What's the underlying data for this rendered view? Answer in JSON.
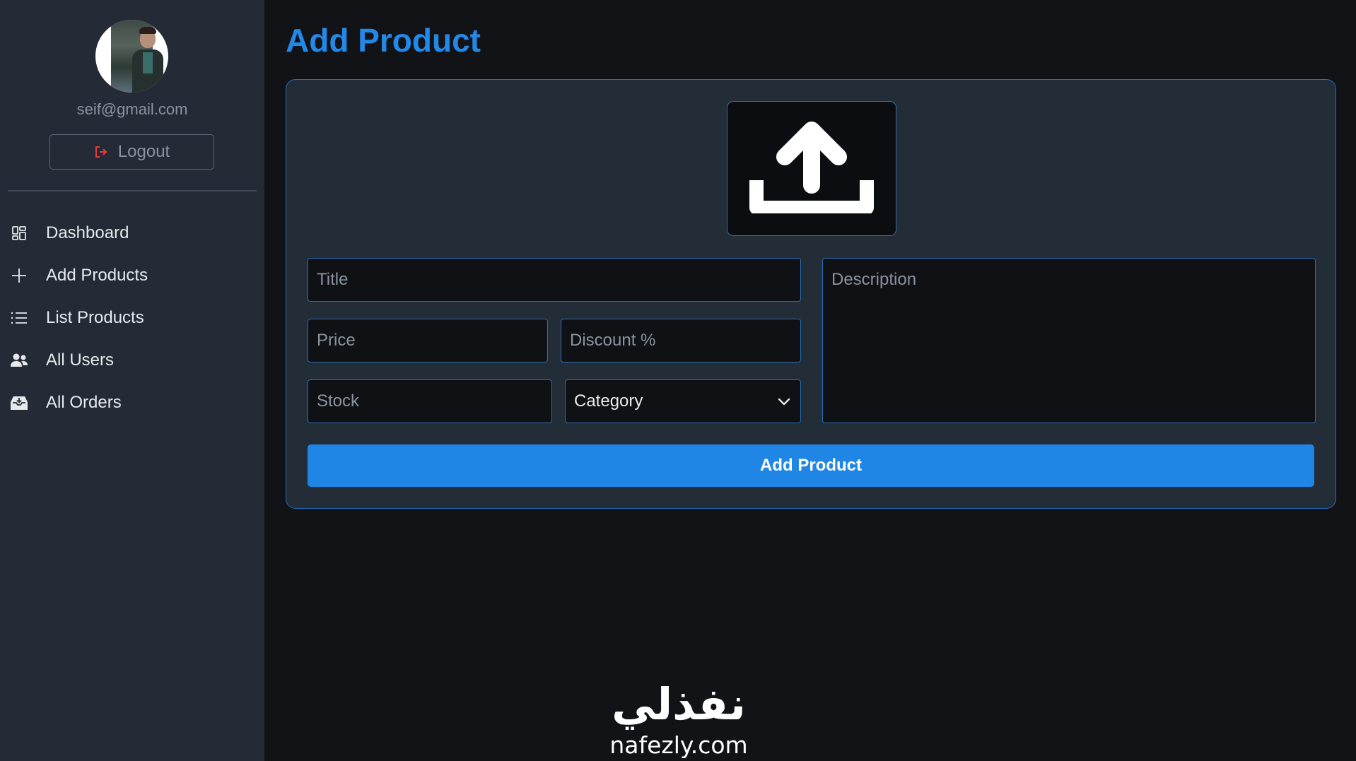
{
  "sidebar": {
    "user_email": "seif@gmail.com",
    "logout_label": "Logout",
    "items": [
      {
        "label": "Dashboard",
        "icon": "dashboard-icon"
      },
      {
        "label": "Add Products",
        "icon": "plus-icon"
      },
      {
        "label": "List Products",
        "icon": "list-icon"
      },
      {
        "label": "All Users",
        "icon": "users-icon"
      },
      {
        "label": "All Orders",
        "icon": "inbox-icon"
      }
    ]
  },
  "main": {
    "title": "Add Product",
    "upload_icon": "upload-icon",
    "form": {
      "title_placeholder": "Title",
      "price_placeholder": "Price",
      "discount_placeholder": "Discount %",
      "stock_placeholder": "Stock",
      "category_selected": "Category",
      "description_placeholder": "Description",
      "submit_label": "Add Product"
    }
  },
  "watermark": {
    "arabic_text": "نفذلي",
    "latin_text": "nafezly.com"
  },
  "colors": {
    "accent": "#2389e8",
    "sidebar_bg": "#242b36",
    "page_bg": "#121316",
    "card_bg": "#232d38",
    "logout_icon": "#e53b3b"
  }
}
